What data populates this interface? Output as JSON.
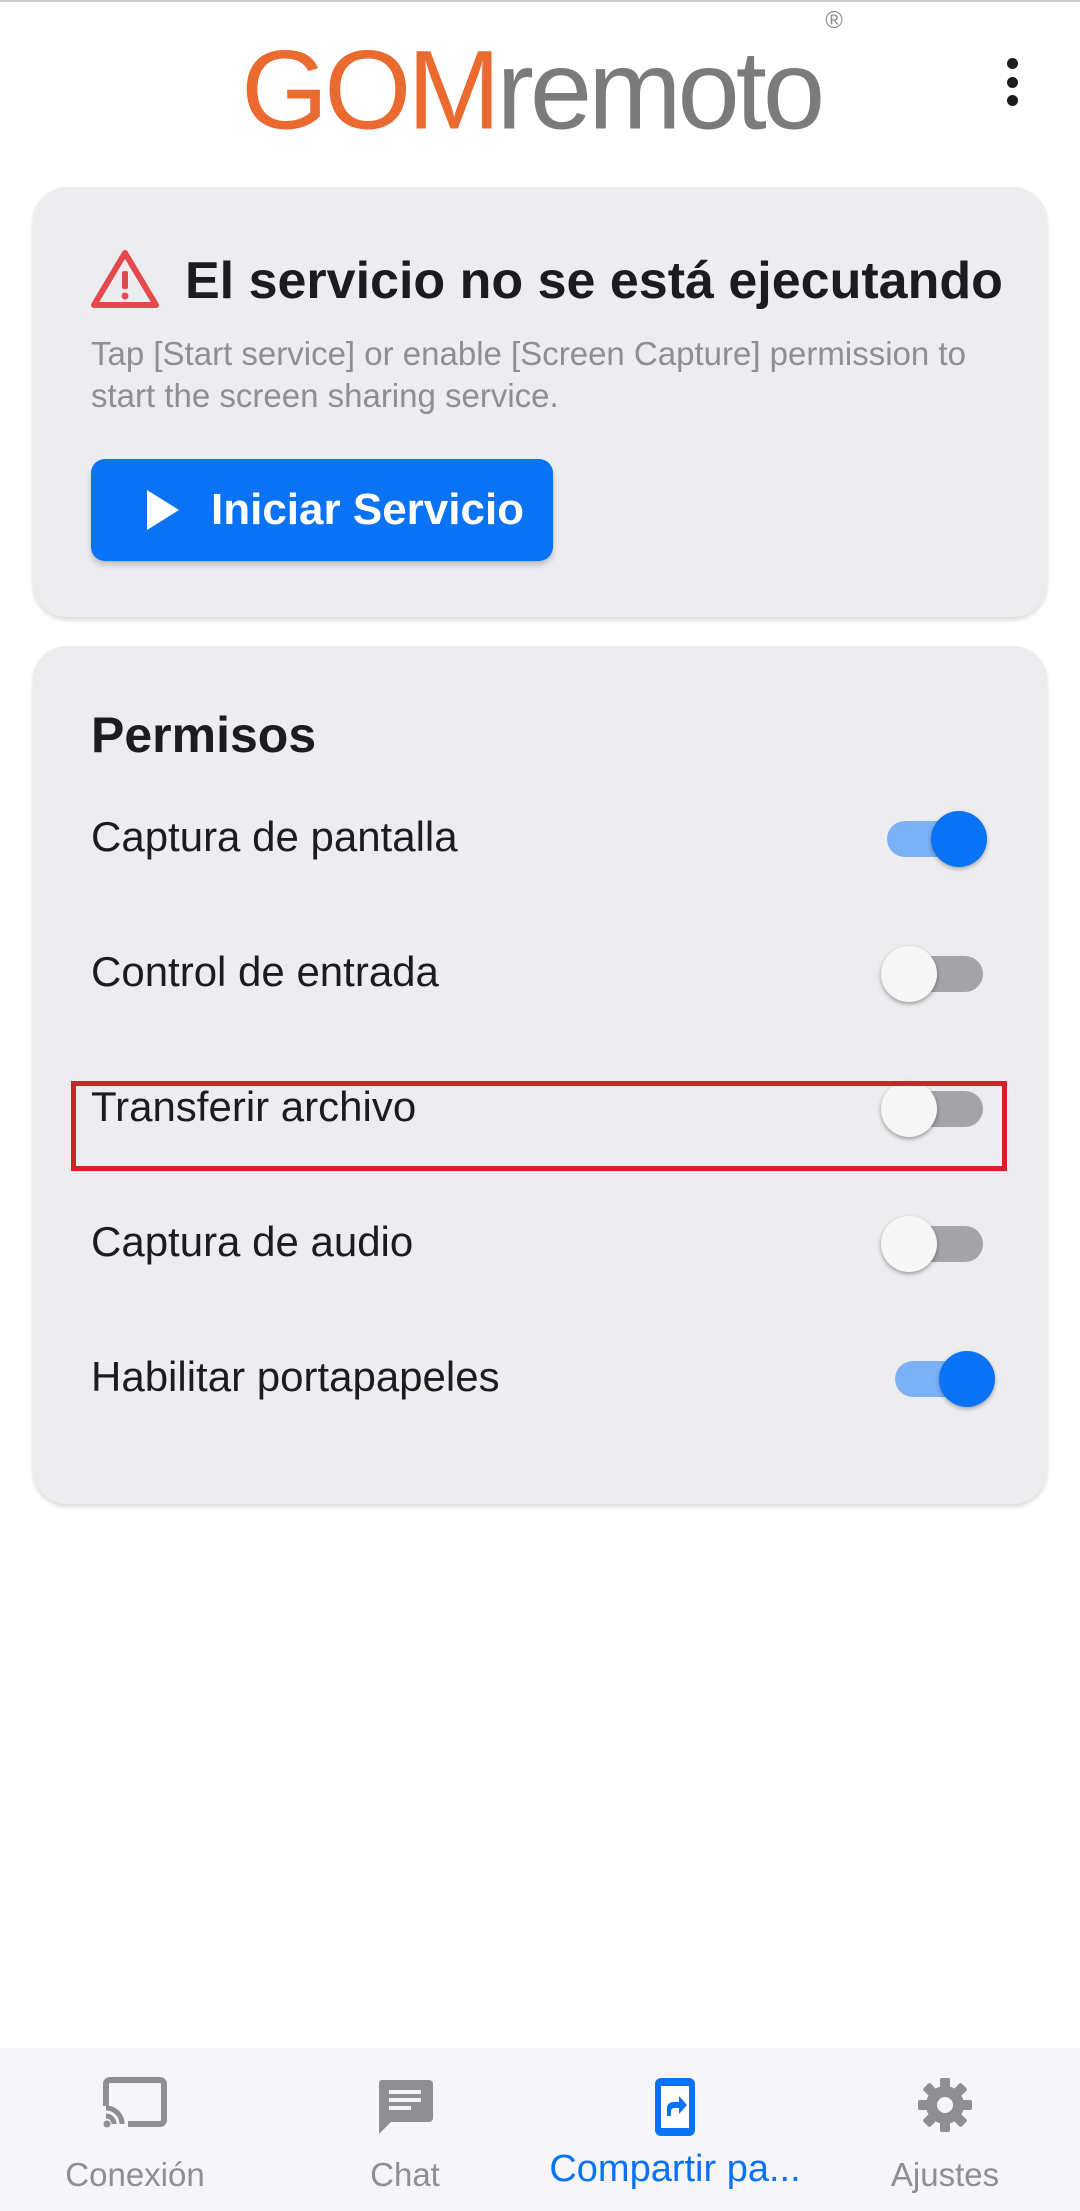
{
  "header": {
    "logo_brand": "GOM",
    "logo_rest": "remoto",
    "logo_mark": "®",
    "menu_icon": "more-vert-icon"
  },
  "service": {
    "title": "El servicio no se está ejecutando",
    "description": "Tap [Start service] or enable [Screen Capture] permission to start the screen sharing service.",
    "start_label": "Iniciar Servicio",
    "warning_icon": "warning-icon",
    "play_icon": "play-icon"
  },
  "permissions": {
    "title": "Permisos",
    "items": [
      {
        "label": "Captura de pantalla",
        "enabled": true
      },
      {
        "label": "Control de entrada",
        "enabled": false
      },
      {
        "label": "Transferir archivo",
        "enabled": false,
        "highlighted": true
      },
      {
        "label": "Captura de audio",
        "enabled": false
      },
      {
        "label": "Habilitar portapapeles",
        "enabled": true
      }
    ]
  },
  "nav": {
    "items": [
      {
        "label": "Conexión",
        "icon": "cast-icon",
        "active": false
      },
      {
        "label": "Chat",
        "icon": "chat-icon",
        "active": false
      },
      {
        "label": "Compartir pa...",
        "icon": "share-screen-icon",
        "active": true
      },
      {
        "label": "Ajustes",
        "icon": "gear-icon",
        "active": false
      }
    ]
  },
  "colors": {
    "accent": "#0a73f5",
    "logo_orange": "#ea6a2f",
    "warning": "#e5484d",
    "highlight": "#d3202a"
  }
}
